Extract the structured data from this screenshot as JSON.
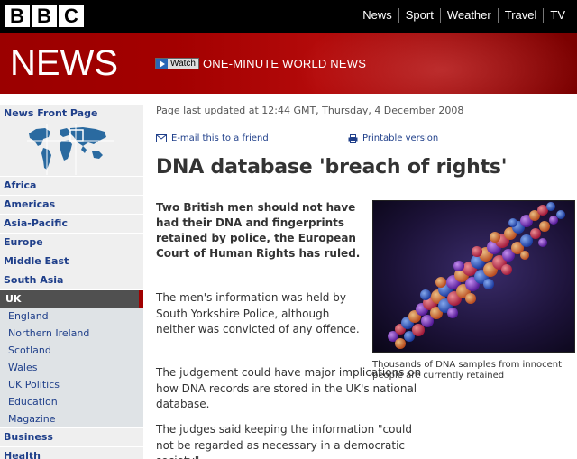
{
  "top_bar": {
    "logo_letters": [
      "B",
      "B",
      "C"
    ],
    "nav": [
      "News",
      "Sport",
      "Weather",
      "Travel",
      "TV"
    ]
  },
  "banner": {
    "title": "NEWS",
    "watch_label": "Watch",
    "watch_text": "ONE-MINUTE WORLD NEWS"
  },
  "sidebar": {
    "front_page": "News Front Page",
    "regions": [
      "Africa",
      "Americas",
      "Asia-Pacific",
      "Europe",
      "Middle East",
      "South Asia"
    ],
    "uk": "UK",
    "uk_sub": [
      "England",
      "Northern Ireland",
      "Scotland",
      "Wales",
      "UK Politics",
      "Education",
      "Magazine"
    ],
    "after": [
      "Business",
      "Health"
    ]
  },
  "article": {
    "updated": "Page last updated at 12:44 GMT, Thursday, 4 December 2008",
    "email": "E-mail this to a friend",
    "print": "Printable version",
    "headline": "DNA database 'breach of rights'",
    "intro": "Two British men should not have had their DNA and fingerprints retained by police, the European Court of Human Rights has ruled.",
    "p1": "The men's information was held by South Yorkshire Police, although neither was convicted of any offence.",
    "p2": "The judgement could have major implications on how DNA records are stored in the UK's national database.",
    "p3": "The judges said keeping the information \"could not be regarded as necessary in a democratic society\".",
    "caption": "Thousands of DNA samples from innocent people are currently retained"
  },
  "colors": {
    "banner_red": "#a30000",
    "link_blue": "#1f3f8a",
    "uk_active": "#505050"
  }
}
